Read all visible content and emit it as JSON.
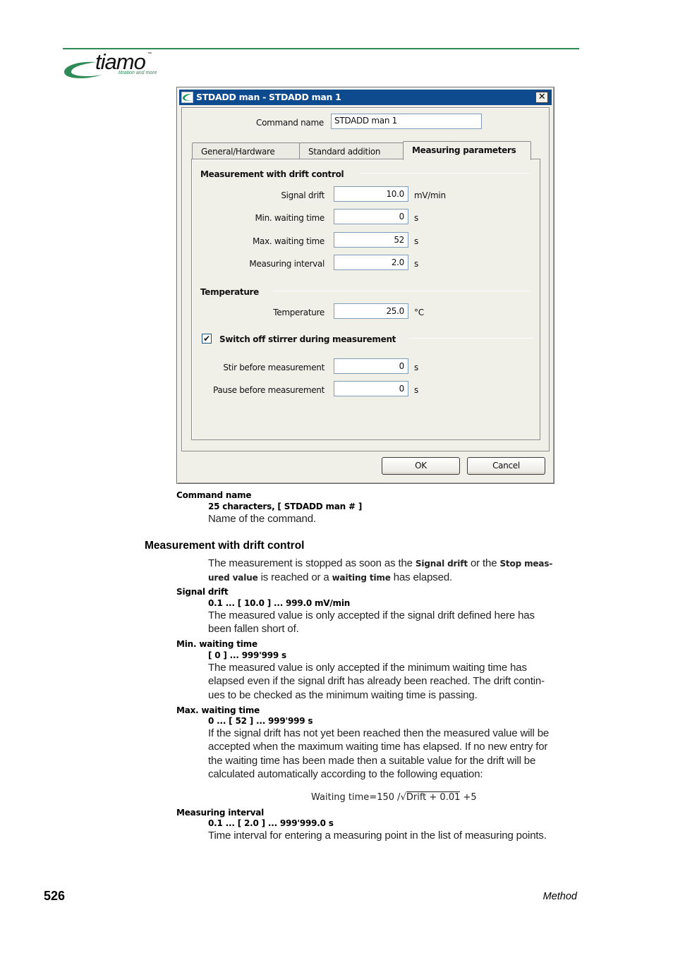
{
  "header": {
    "logo": {
      "word": "tiamo",
      "trademark": "™",
      "tagline": "titration and more",
      "icon": "tiamo-swoosh-logo"
    },
    "accent_color": "#2e8b57"
  },
  "dialog": {
    "title": "STDADD man - STDADD man 1",
    "title_icon": "tiamo-app-icon",
    "close_icon": "✕",
    "command_name_label": "Command name",
    "command_name_value": "STDADD man 1",
    "tabs": [
      {
        "label": "General/Hardware",
        "active": false
      },
      {
        "label": "Standard addition",
        "active": false
      },
      {
        "label": "Measuring parameters",
        "active": true
      }
    ],
    "groups": {
      "drift": {
        "title": "Measurement with drift control",
        "fields": [
          {
            "label": "Signal drift",
            "value": "10.0",
            "unit": "mV/min"
          },
          {
            "label": "Min. waiting time",
            "value": "0",
            "unit": "s"
          },
          {
            "label": "Max. waiting time",
            "value": "52",
            "unit": "s"
          },
          {
            "label": "Measuring interval",
            "value": "2.0",
            "unit": "s"
          }
        ]
      },
      "temperature": {
        "title": "Temperature",
        "fields": [
          {
            "label": "Temperature",
            "value": "25.0",
            "unit": "°C"
          }
        ]
      },
      "stirrer": {
        "title": "Switch off stirrer during measurement",
        "checked": true,
        "check_glyph": "✔",
        "fields": [
          {
            "label": "Stir before measurement",
            "value": "0",
            "unit": "s"
          },
          {
            "label": "Pause before measurement",
            "value": "0",
            "unit": "s"
          }
        ]
      }
    },
    "buttons": {
      "ok": "OK",
      "cancel": "Cancel"
    },
    "title_bar_color": "#0d4a8e"
  },
  "doc": {
    "command_name": {
      "name": "Command name",
      "range": "25 characters, [ STDADD man # ]",
      "desc": "Name of the command."
    },
    "section_heading": "Measurement with drift control",
    "intro": {
      "t1": "The measurement is stopped as soon as the ",
      "b1": "Signal drift",
      "t2": " or the ",
      "b2": "Stop meas-",
      "b3": "ured value",
      "t3": " is reached or a ",
      "b4": "waiting time",
      "t4": " has elapsed."
    },
    "params": [
      {
        "name": "Signal drift",
        "range": "0.1 ... [ 10.0 ] ... 999.0 mV/min",
        "lines": [
          "The measured value is only accepted if the signal drift defined here has",
          "been fallen short of."
        ]
      },
      {
        "name": "Min. waiting time",
        "range": "[ 0 ] ... 999'999 s",
        "lines": [
          "The measured value is only accepted if the minimum waiting time has",
          "elapsed even if the signal drift has already been reached. The drift contin-",
          "ues to be checked as the minimum waiting time is passing."
        ]
      },
      {
        "name": "Max. waiting time",
        "range": "0 ... [ 52 ] ... 999'999 s",
        "lines": [
          "If the signal drift has not yet been reached then the measured value will be",
          "accepted when the maximum waiting time has elapsed. If no new entry for",
          "the waiting time has been made then a suitable value for the drift will be",
          "calculated automatically according to the following equation:"
        ]
      },
      {
        "name": "Measuring interval",
        "range": "0.1 ... [ 2.0 ] ... 999'999.0 s",
        "lines": [
          "Time interval for entering a measuring point in the list of measuring points."
        ]
      }
    ],
    "equation": {
      "lhs": "Waiting time",
      "eq": "=",
      "num": "150",
      "div": " /",
      "sqrt": "√",
      "radicand": "Drift + 0.01",
      "tail": " +5"
    }
  },
  "footer": {
    "page_number": "526",
    "section": "Method"
  }
}
